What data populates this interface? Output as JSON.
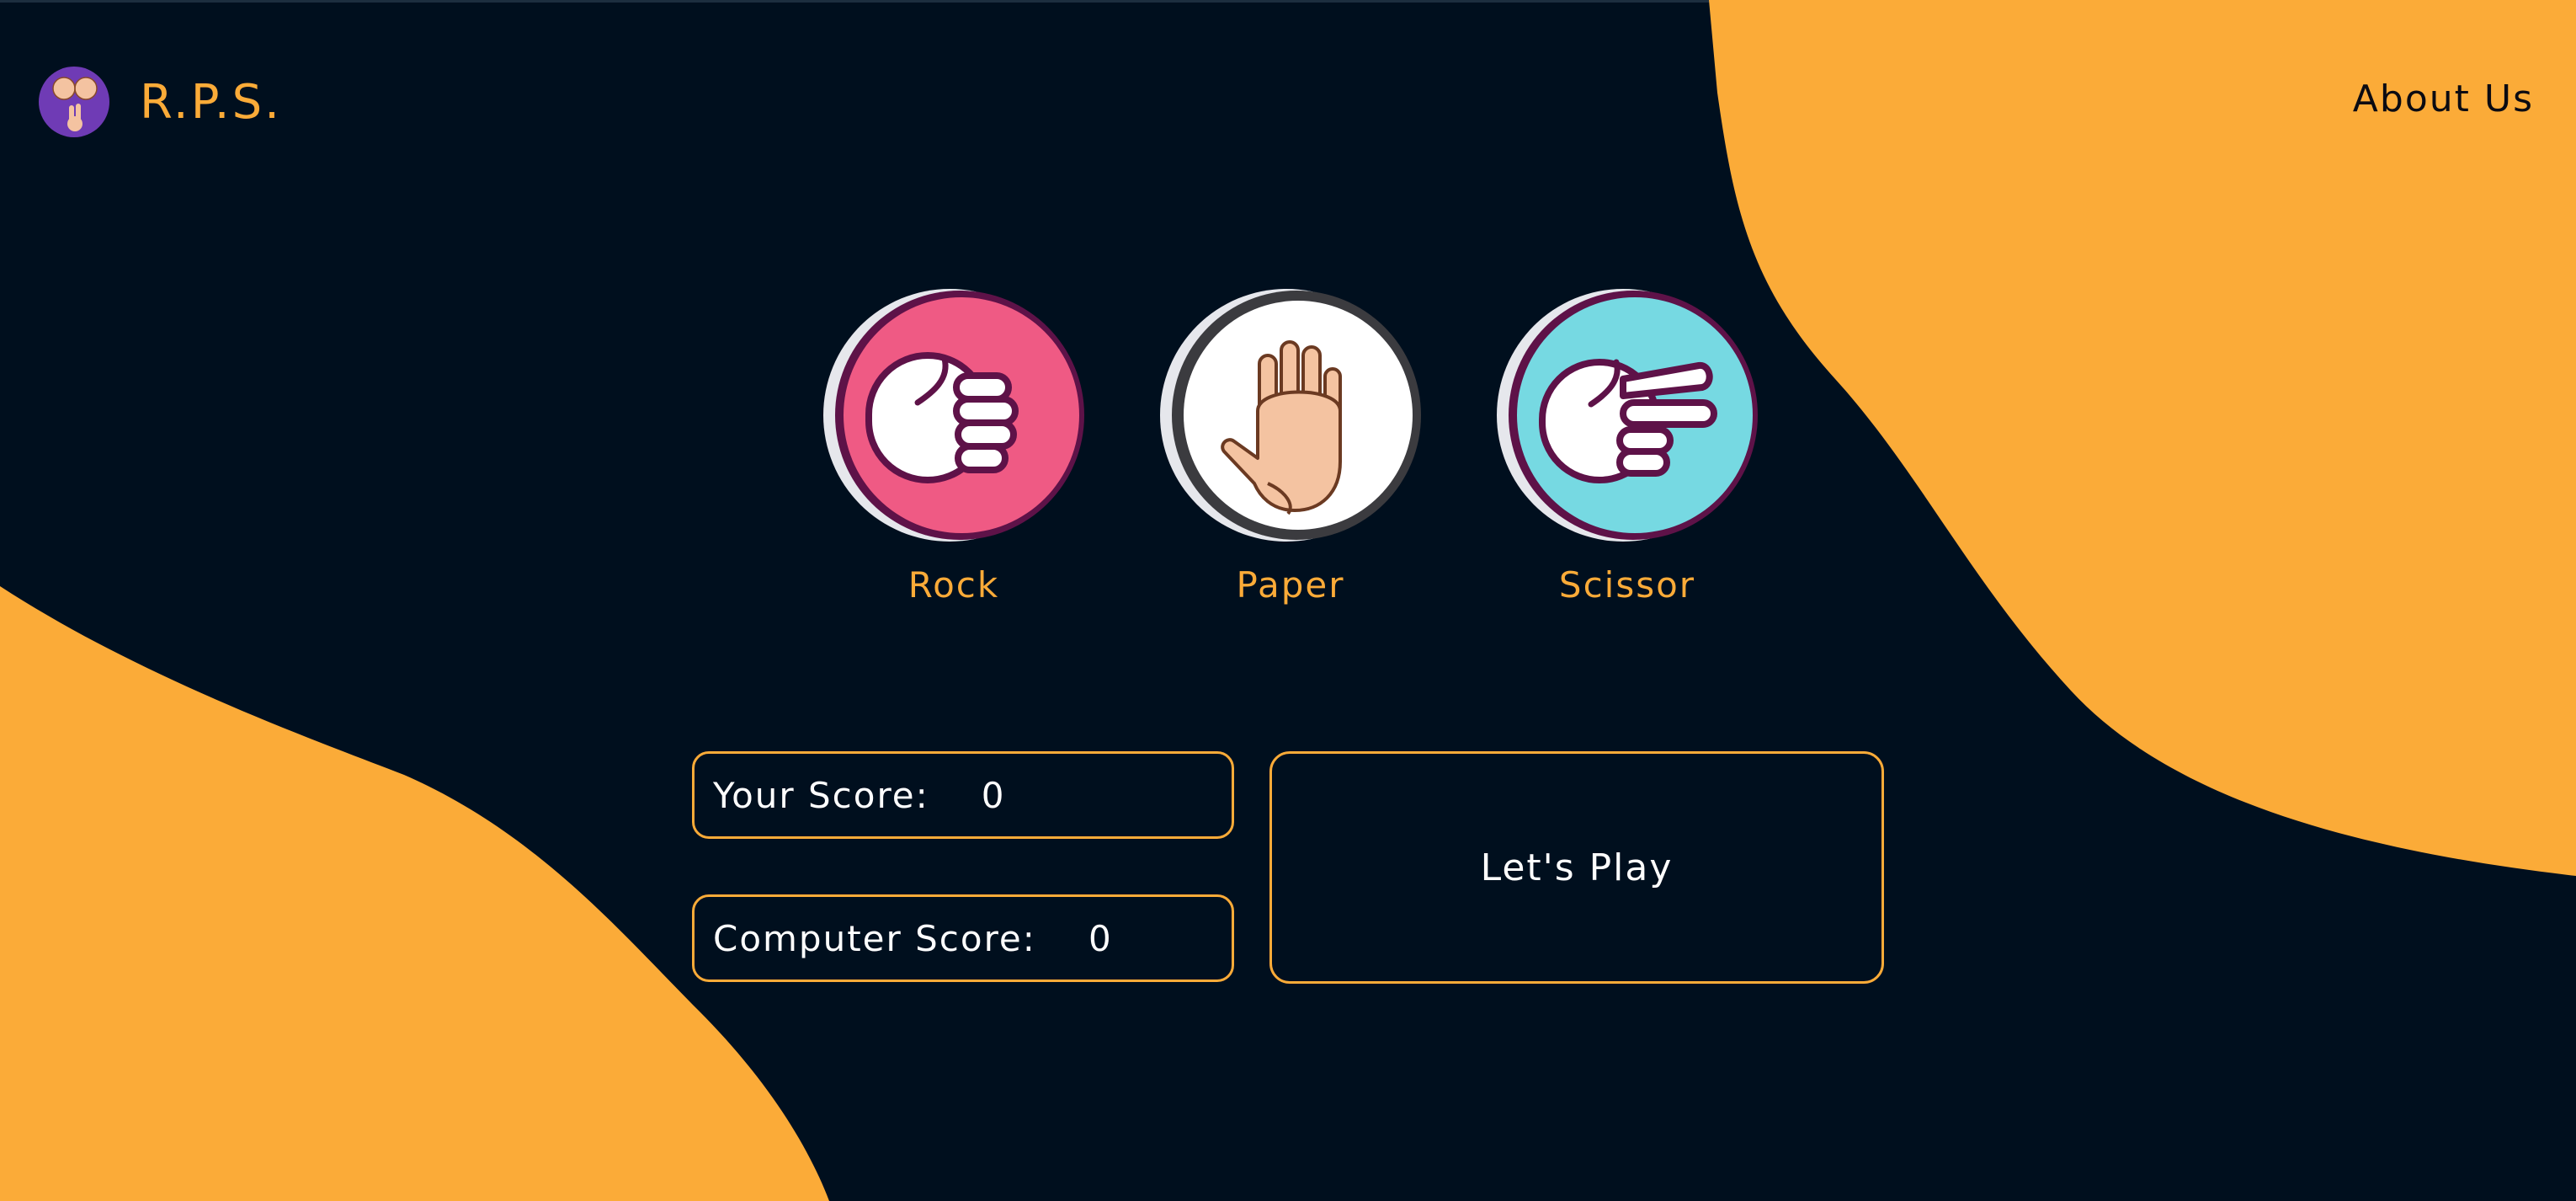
{
  "header": {
    "brand": "R.P.S.",
    "nav_about": "About Us"
  },
  "choices": [
    {
      "label": "Rock",
      "icon": "fist-icon",
      "color": "#ef5a84"
    },
    {
      "label": "Paper",
      "icon": "open-hand-icon",
      "color": "#ffffff"
    },
    {
      "label": "Scissor",
      "icon": "scissors-hand-icon",
      "color": "#76d9e2"
    }
  ],
  "scores": {
    "your_label": "Your Score:",
    "your_value": "0",
    "computer_label": "Computer Score:",
    "computer_value": "0"
  },
  "play_button": "Let's Play",
  "colors": {
    "background": "#000f1e",
    "accent": "#fbab38",
    "outline": "#5e1248"
  }
}
